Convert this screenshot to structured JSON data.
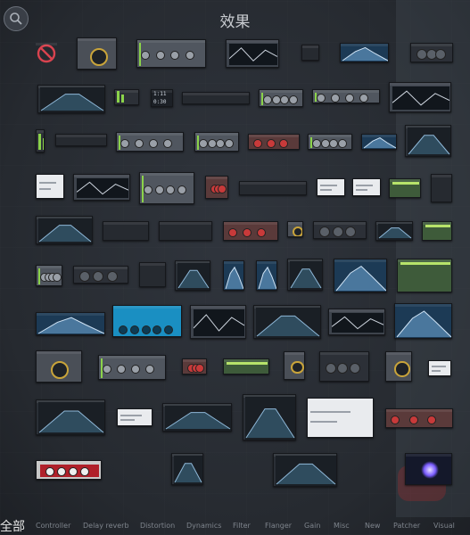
{
  "header": {
    "title": "效果"
  },
  "categories": [
    {
      "label": "全部",
      "active": true
    },
    {
      "label": "Controller",
      "active": false
    },
    {
      "label": "Delay reverb",
      "active": false
    },
    {
      "label": "Distortion",
      "active": false
    },
    {
      "label": "Dynamics",
      "active": false
    },
    {
      "label": "Filter",
      "active": false
    },
    {
      "label": "Flanger",
      "active": false
    },
    {
      "label": "Gain",
      "active": false
    },
    {
      "label": "Misc",
      "active": false
    },
    {
      "label": "New",
      "active": false
    },
    {
      "label": "Patcher",
      "active": false
    },
    {
      "label": "Visual",
      "active": false
    }
  ],
  "colors": {
    "background": "#2b2f36",
    "tile": "#3b4048",
    "accent_green": "#8bd34a",
    "accent_blue": "#2aa3d8",
    "accent_red": "#c83a3a"
  },
  "icons": {
    "search": "search-icon",
    "none": "no-effect-icon"
  },
  "thumbnail_labels": {
    "t_time_display_1": "1:11",
    "t_time_display_2": "0:30"
  }
}
